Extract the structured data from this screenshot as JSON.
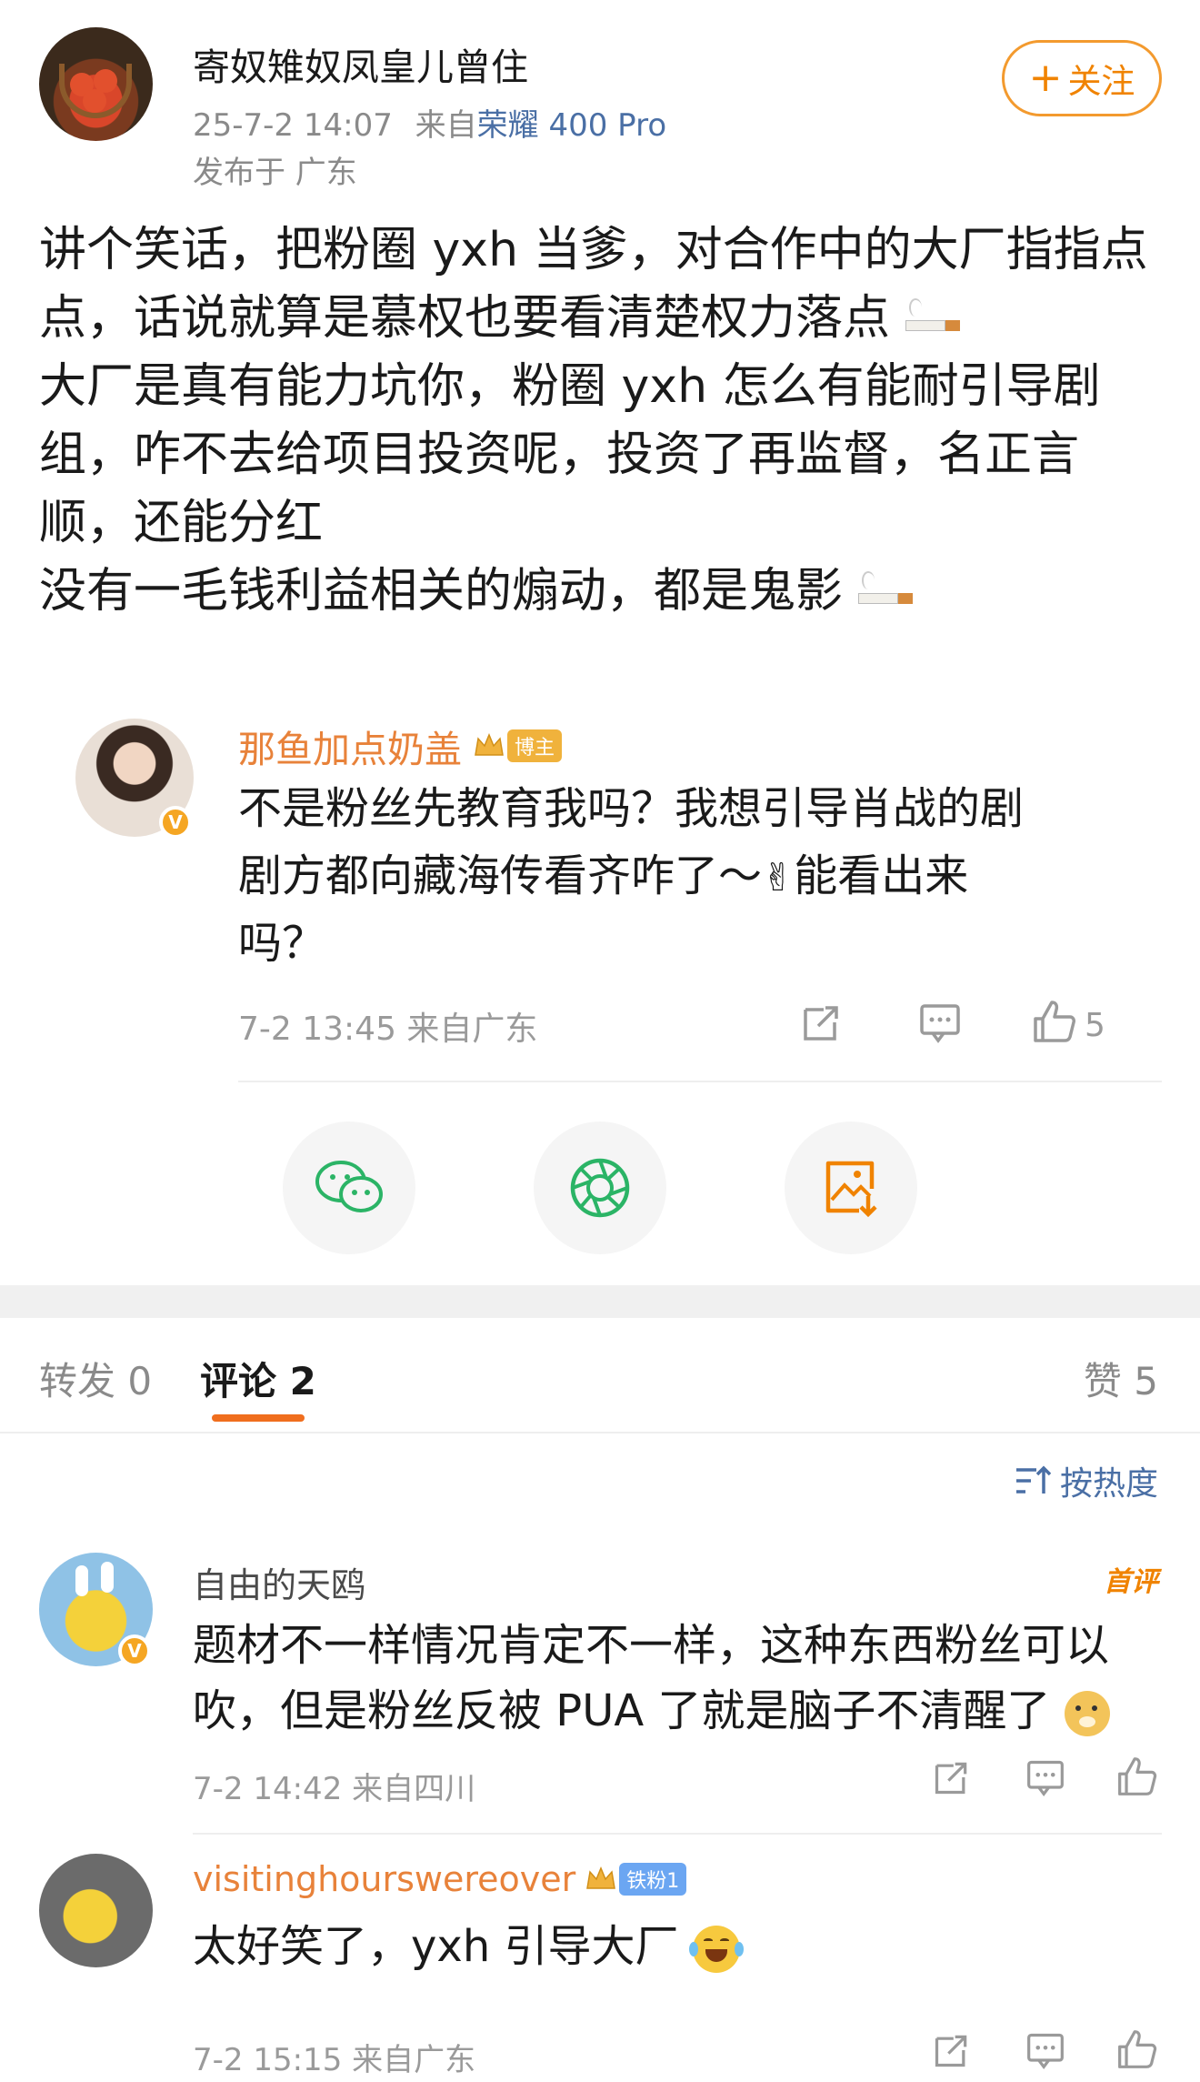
{
  "post": {
    "author": "寄奴雉奴凤皇儿曾住",
    "timestamp": "25-7-2 14:07",
    "source_prefix": "来自",
    "device": "荣耀 400 Pro",
    "location": "发布于 广东",
    "follow_label": "关注",
    "follow_plus": "+",
    "lines": [
      "讲个笑话，把粉圈 yxh 当爹，对合作中的大厂指指点",
      "点，话说就算是慕权也要看清楚权力落点",
      "大厂是真有能力坑你，粉圈 yxh 怎么有能耐引导剧",
      "组，咋不去给项目投资呢，投资了再监督，名正言",
      "顺，还能分红",
      "没有一毛钱利益相关的煽动，都是鬼影"
    ]
  },
  "quote": {
    "author": "那鱼加点奶盖",
    "badge": "博主",
    "lines": [
      "不是粉丝先教育我吗？我想引导肖战的剧",
      "剧方都向藏海传看齐咋了～",
      "吗？"
    ],
    "inline_tail": "能看出来",
    "time": "7-2 13:45 来自广东",
    "like_count": "5"
  },
  "tabs": {
    "repost": "转发 0",
    "comment": "评论 2",
    "like": "赞 5"
  },
  "sort_label": "按热度",
  "comments": [
    {
      "author": "自由的天鸥",
      "tag": "首评",
      "lines": [
        "题材不一样情况肯定不一样，这种东西粉丝可以",
        "吹，但是粉丝反被 PUA 了就是脑子不清醒了"
      ],
      "meta": "7-2 14:42 来自四川"
    },
    {
      "author": "visitinghourswereover",
      "badge": "铁粉1",
      "text": "太好笑了，yxh 引导大厂",
      "meta": "7-2 15:15 来自广东"
    }
  ],
  "colors": {
    "accent_orange": "#f08300",
    "link_blue": "#4a6fa5",
    "muted": "#9a9a9a"
  }
}
